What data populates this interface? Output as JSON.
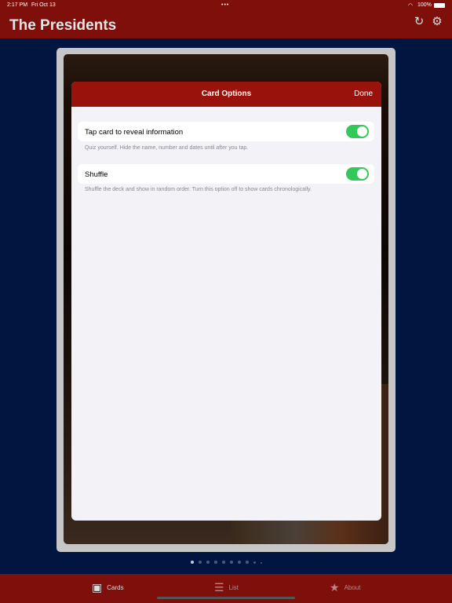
{
  "status": {
    "time": "2:17 PM",
    "date": "Fri Oct 13",
    "battery": "100%"
  },
  "header": {
    "title": "The Presidents"
  },
  "modal": {
    "title": "Card Options",
    "done_label": "Done",
    "options": [
      {
        "label": "Tap card to reveal information",
        "footer": "Quiz yourself.  Hide the name, number and dates until after you tap.",
        "on": true
      },
      {
        "label": "Shuffle",
        "footer": "Shuffle the deck and show in random order.  Turn this option off to show cards chronologically.",
        "on": true
      }
    ]
  },
  "pager": {
    "count": 10,
    "current": 1
  },
  "tabs": [
    {
      "label": "Cards",
      "icon": "person-card-icon",
      "active": true
    },
    {
      "label": "List",
      "icon": "list-icon",
      "active": false
    },
    {
      "label": "About",
      "icon": "star-icon",
      "active": false
    }
  ],
  "colors": {
    "brand": "#7e0f0b",
    "background": "#001640",
    "toggle_on": "#34c759"
  }
}
